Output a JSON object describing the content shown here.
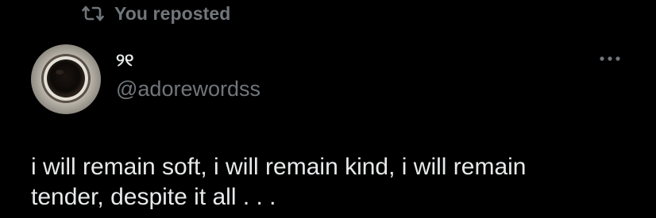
{
  "repost": {
    "icon": "repost-icon",
    "label": "You reposted"
  },
  "author": {
    "display_name": "୨୧",
    "handle": "@adorewordss",
    "avatar": "coffee-cup-avatar"
  },
  "more_icon": "more-options-icon",
  "tweet": {
    "text": "i will remain soft, i will remain kind, i will remain\ntender, despite it all . . ."
  },
  "colors": {
    "background": "#000000",
    "primary_text": "#e7e9ea",
    "secondary_text": "#71767b"
  }
}
